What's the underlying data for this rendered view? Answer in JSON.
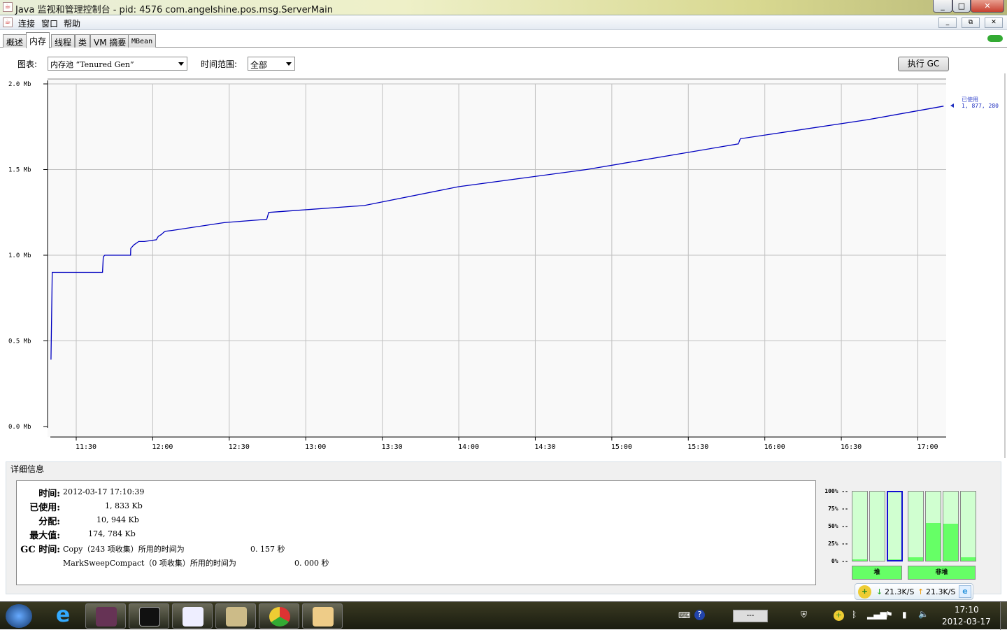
{
  "window": {
    "title": "Java 监视和管理控制台 - pid: 4576 com.angelshine.pos.msg.ServerMain",
    "minimize": "_",
    "maximize": "□",
    "close": "✕"
  },
  "menu": [
    "连接",
    "窗口",
    "帮助"
  ],
  "mdi": {
    "minimize": "_",
    "restore": "⧉",
    "close": "✕"
  },
  "tabs": [
    "概述",
    "内存",
    "线程",
    "类",
    "VM 摘要",
    "MBean"
  ],
  "controls": {
    "chart_label": "图表:",
    "chart_value": "内存池 “Tenured Gen”",
    "range_label": "时间范围:",
    "range_value": "全部",
    "gc_button": "执行 GC"
  },
  "chart_data": {
    "type": "line",
    "title": "",
    "ylabel": "",
    "xlabel": "",
    "ylim": [
      0,
      2.0
    ],
    "y_ticks": [
      "0.0 Mb",
      "0.5 Mb",
      "1.0 Mb",
      "1.5 Mb",
      "2.0 Mb"
    ],
    "x_ticks": [
      "11:30",
      "12:00",
      "12:30",
      "13:00",
      "13:30",
      "14:00",
      "14:30",
      "15:00",
      "15:30",
      "16:00",
      "16:30",
      "17:00"
    ],
    "x_unit": "minutes since midnight",
    "xlim": [
      679,
      1032
    ],
    "series": [
      {
        "name": "已使用",
        "color": "#0000c0",
        "x": [
          680.1,
          680.6,
          700.3,
          700.6,
          701.2,
          711.3,
          711.4,
          712.6,
          714.5,
          716.7,
          721.4,
          722.2,
          723.3,
          724.4,
          725,
          727.7,
          748,
          764.7,
          765.5,
          803,
          839.9,
          890,
          949.6,
          950.4,
          1000,
          1030.1
        ],
        "y": [
          0.39,
          0.9,
          0.9,
          0.99,
          1.0,
          1.0,
          1.04,
          1.06,
          1.08,
          1.08,
          1.09,
          1.11,
          1.12,
          1.135,
          1.14,
          1.145,
          1.19,
          1.21,
          1.25,
          1.29,
          1.4,
          1.5,
          1.65,
          1.68,
          1.79,
          1.87
        ]
      }
    ],
    "legend": {
      "label": "已使用",
      "value": "1, 877, 280",
      "placement": "right"
    },
    "grid": true
  },
  "details": {
    "legend": "详细信息",
    "time_label": "时间:",
    "time": "2012-03-17 17:10:39",
    "used_label": "已使用:",
    "used": "1, 833 Kb",
    "committed_label": "分配:",
    "committed": "10, 944 Kb",
    "max_label": "最大值:",
    "max": "174, 784 Kb",
    "gc_label": "GC 时间:",
    "gc": [
      {
        "text": "Copy（243 项收集）所用的时间为",
        "value": "0. 157  秒"
      },
      {
        "text": "MarkSweepCompact（0 项收集）所用的时间为",
        "value": "0. 000  秒"
      }
    ]
  },
  "pools": {
    "pct_labels": [
      "100% --",
      "75% --",
      "50% --",
      "25% --",
      "0% --"
    ],
    "bars": [
      {
        "fill": 2
      },
      {
        "fill": 0
      },
      {
        "fill": 1,
        "selected": true
      },
      {
        "fill": 5
      },
      {
        "fill": 55
      },
      {
        "fill": 54
      },
      {
        "fill": 5
      }
    ],
    "heap": "堆",
    "nonheap": "非堆"
  },
  "net": {
    "down": "21.3K/S",
    "up": "21.3K/S"
  },
  "tray": {
    "time": "17:10",
    "date": "2012-03-17",
    "input": "---"
  }
}
